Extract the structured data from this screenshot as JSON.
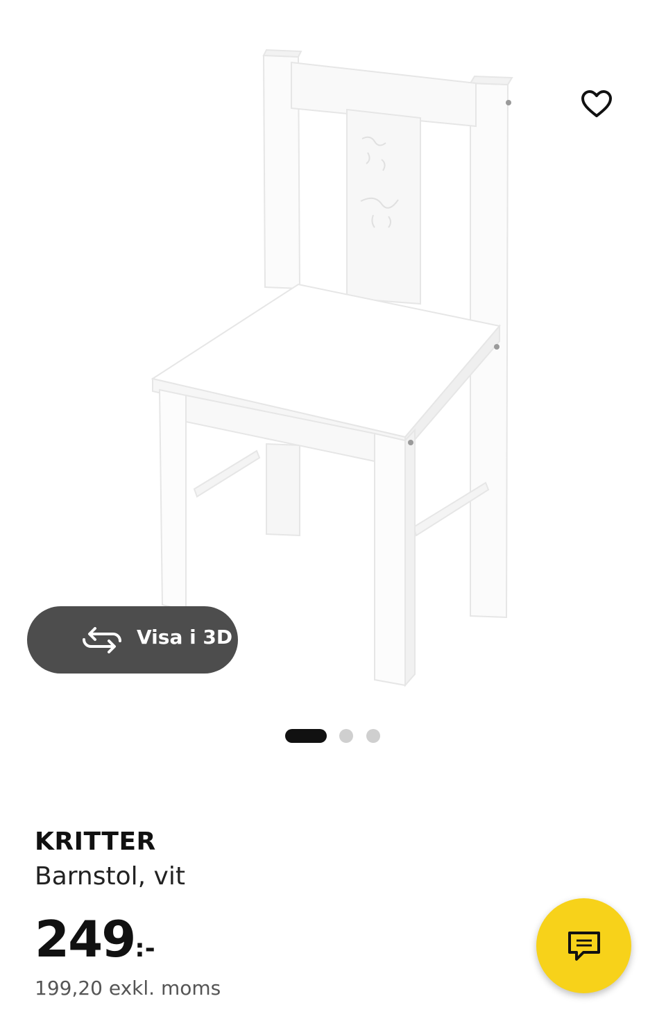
{
  "gallery": {
    "view_3d_label": "Visa i 3D",
    "active_slide": 1,
    "slide_count": 3
  },
  "product": {
    "name": "KRITTER",
    "description": "Barnstol, vit",
    "price_integer": "249",
    "price_suffix": ":-",
    "price_excl_vat": "199,20 exkl. moms"
  },
  "icons": {
    "favorite": "heart-outline-icon",
    "view_3d": "rotate-3d-icon",
    "chat": "chat-bubble-icon"
  },
  "colors": {
    "chat_fab": "#f7d21a",
    "view_3d_bg": "#4d4d4d"
  }
}
